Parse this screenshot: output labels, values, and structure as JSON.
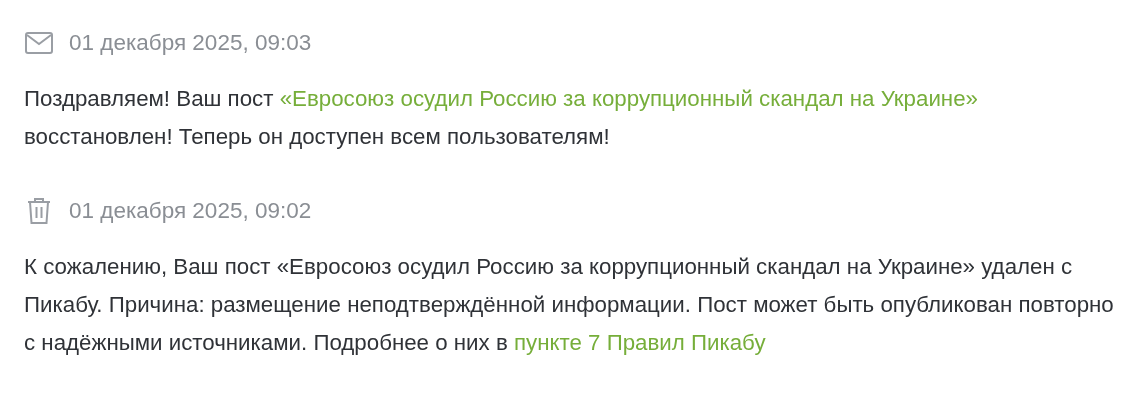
{
  "notifications": [
    {
      "kind": "restored",
      "date": "01 декабря 2025, 09:03",
      "text_before": "Поздравляем! Ваш пост ",
      "link": "«Евросоюз осудил Россию за коррупционный скандал на Украине»",
      "text_after": " восстановлен! Теперь он доступен всем пользователям!"
    },
    {
      "kind": "deleted",
      "date": "01 декабря 2025, 09:02",
      "text_before": "К сожалению, Ваш пост «Евросоюз осудил Россию за коррупционный скандал на Украине» удален с Пикабу. Причина: размещение неподтверждённой информации. Пост может быть опубликован повторно с надёжными источниками. Подробнее о них в ",
      "link": "пункте 7 Правил Пикабу"
    }
  ]
}
